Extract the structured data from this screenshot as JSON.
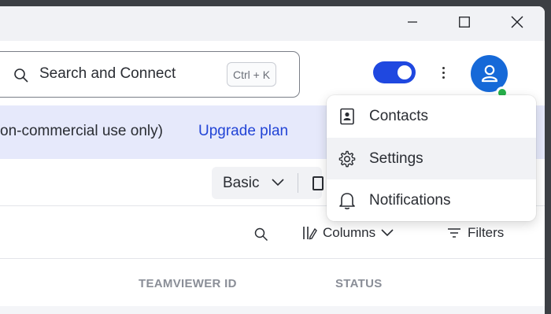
{
  "window_controls": {
    "minimize_icon": "minimize-icon",
    "maximize_icon": "maximize-icon",
    "close_icon": "close-icon"
  },
  "header": {
    "search": {
      "placeholder": "Search and Connect",
      "shortcut": "Ctrl + K",
      "icon": "search-icon"
    },
    "toggle": {
      "on": true,
      "color": "#1f48e0"
    },
    "more_icon": "kebab-menu-icon",
    "avatar": {
      "icon": "user-icon",
      "color": "#1669d8",
      "status": "online",
      "status_color": "#26b04a"
    }
  },
  "banner": {
    "text": "on-commercial use only)",
    "link": "Upgrade plan",
    "link_color": "#2244d6",
    "background": "#e6e9fb"
  },
  "toolbar": {
    "view_label": "Basic"
  },
  "filterbar": {
    "columns_label": "Columns",
    "filters_label": "Filters"
  },
  "table": {
    "headers": [
      "TEAMVIEWER ID",
      "STATUS"
    ]
  },
  "dropdown_menu": {
    "items": [
      {
        "label": "Contacts",
        "icon": "contacts-icon"
      },
      {
        "label": "Settings",
        "icon": "gear-icon",
        "hovered": true
      },
      {
        "label": "Notifications",
        "icon": "bell-icon"
      }
    ]
  }
}
